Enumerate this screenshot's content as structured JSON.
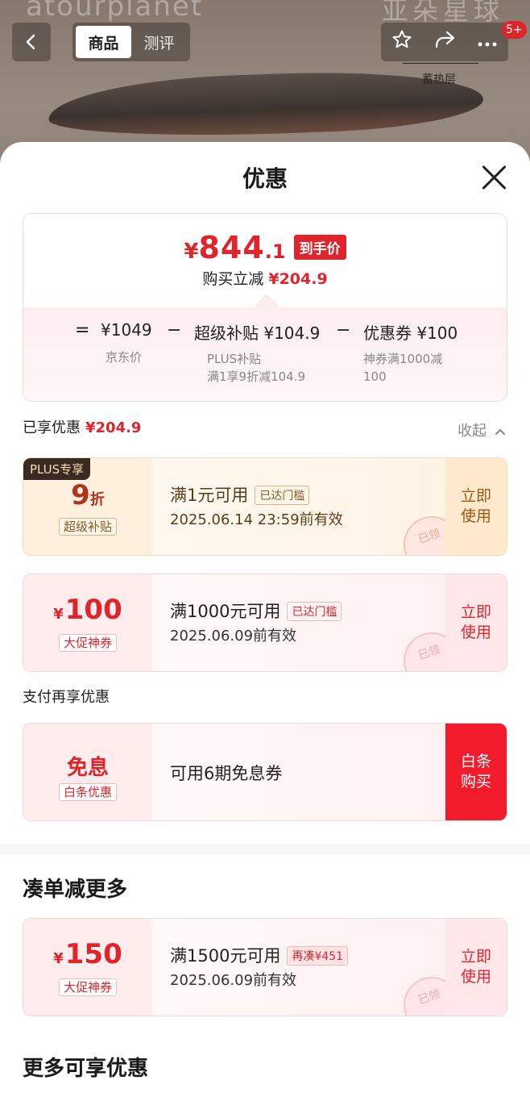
{
  "background": {
    "brand_left": "atourplanet",
    "brand_right": "亚朵星球",
    "hot_layer_label": "蓄热层",
    "tabs": [
      "商品",
      "测评"
    ],
    "badge": "5+"
  },
  "sheet": {
    "title": "优惠"
  },
  "summary": {
    "price_symbol": "¥",
    "price_int": "844",
    "price_dec": ".1",
    "price_tag": "到手价",
    "save_label": "购买立减",
    "save_amount": "¥204.9",
    "eq": "=",
    "minus": "−",
    "jd_price": "¥1049",
    "jd_label": "京东价",
    "subsidy": "超级补贴 ¥104.9",
    "subsidy_note1": "PLUS补贴",
    "subsidy_note2": "满1享9折减104.9",
    "coupon": "优惠券 ¥100",
    "coupon_note1": "神券满1000减",
    "coupon_note2": "100"
  },
  "enjoyed": {
    "label": "已享优惠",
    "amount": "¥204.9",
    "collapse": "收起"
  },
  "coupons": [
    {
      "plus_label": "PLUS专享",
      "amount_num": "9",
      "amount_unit": "折",
      "kind": "超级补贴",
      "title": "满1元可用",
      "tag": "已达门槛",
      "date": "2025.06.14 23:59前有效",
      "action_line1": "立即",
      "action_line2": "使用",
      "stamp": "已领"
    },
    {
      "currency": "¥",
      "amount_num": "100",
      "kind": "大促神券",
      "title": "满1000元可用",
      "tag": "已达门槛",
      "date": "2025.06.09前有效",
      "action_line1": "立即",
      "action_line2": "使用",
      "stamp": "已领"
    }
  ],
  "pay": {
    "label": "支付再享优惠",
    "left_title": "免息",
    "kind": "白条优惠",
    "title": "可用6期免息券",
    "action_line1": "白条",
    "action_line2": "购买"
  },
  "more_discount": {
    "heading": "凑单减更多",
    "currency": "¥",
    "amount_num": "150",
    "kind": "大促神券",
    "title": "满1500元可用",
    "tag": "再凑¥451",
    "date": "2025.06.09前有效",
    "action_line1": "立即",
    "action_line2": "使用",
    "stamp": "已领"
  },
  "more_heading": "更多可享优惠",
  "colors": {
    "accent_red": "#e0242c",
    "plus_gold": "#9b5a12"
  }
}
